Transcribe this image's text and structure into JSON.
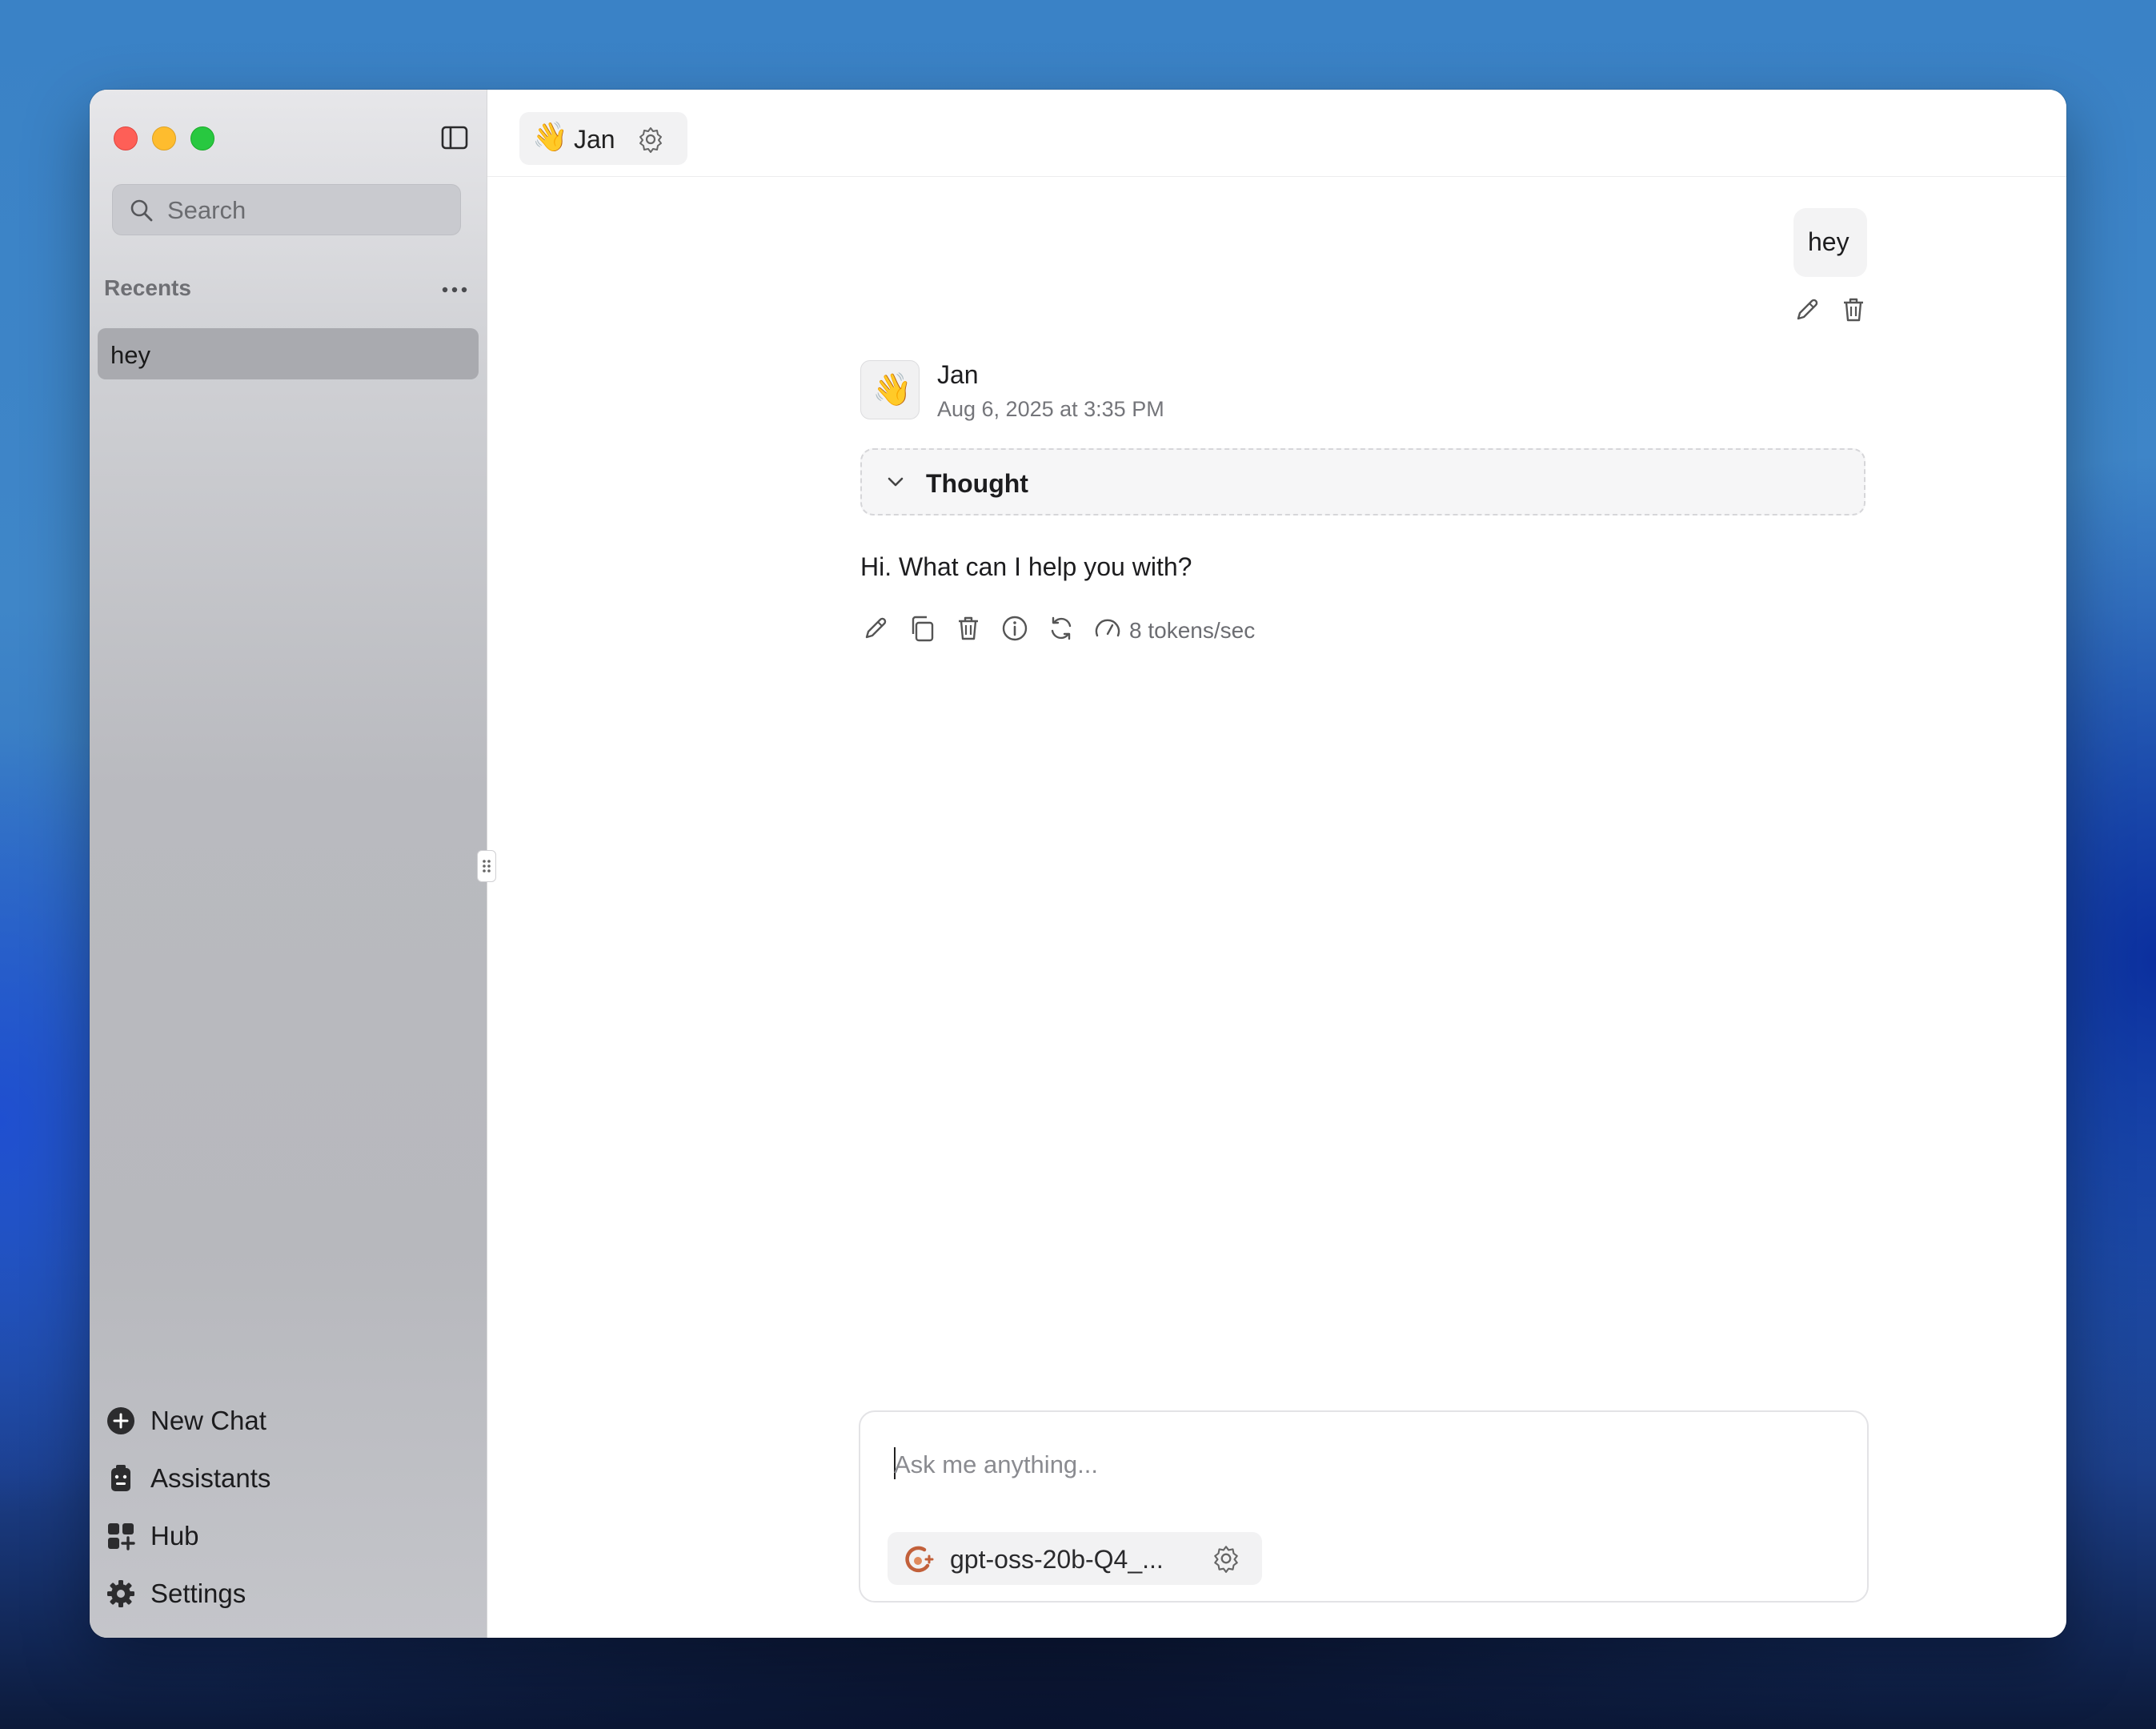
{
  "window": {
    "traffic_lights": [
      "close",
      "minimize",
      "zoom"
    ]
  },
  "sidebar": {
    "search_placeholder": "Search",
    "recents_label": "Recents",
    "recent_items": [
      {
        "label": "hey"
      }
    ],
    "nav": [
      {
        "label": "New Chat",
        "icon": "plus-circle-icon"
      },
      {
        "label": "Assistants",
        "icon": "assistant-icon"
      },
      {
        "label": "Hub",
        "icon": "grid-plus-icon"
      },
      {
        "label": "Settings",
        "icon": "gear-icon"
      }
    ]
  },
  "header": {
    "assistant_emoji": "👋",
    "assistant_name": "Jan"
  },
  "conversation": {
    "user_message": "hey",
    "assistant": {
      "emoji": "👋",
      "name": "Jan",
      "timestamp": "Aug 6, 2025 at 3:35 PM",
      "thought_label": "Thought",
      "reply": "Hi. What can I help you with?",
      "tokens_per_sec": "8 tokens/sec"
    }
  },
  "composer": {
    "placeholder": "Ask me anything...",
    "model_name": "gpt-oss-20b-Q4_..."
  },
  "colors": {
    "close": "#fe5f57",
    "minimize": "#febc2e",
    "zoom": "#28c840",
    "sidebar_selected": "#a9aaaf"
  }
}
